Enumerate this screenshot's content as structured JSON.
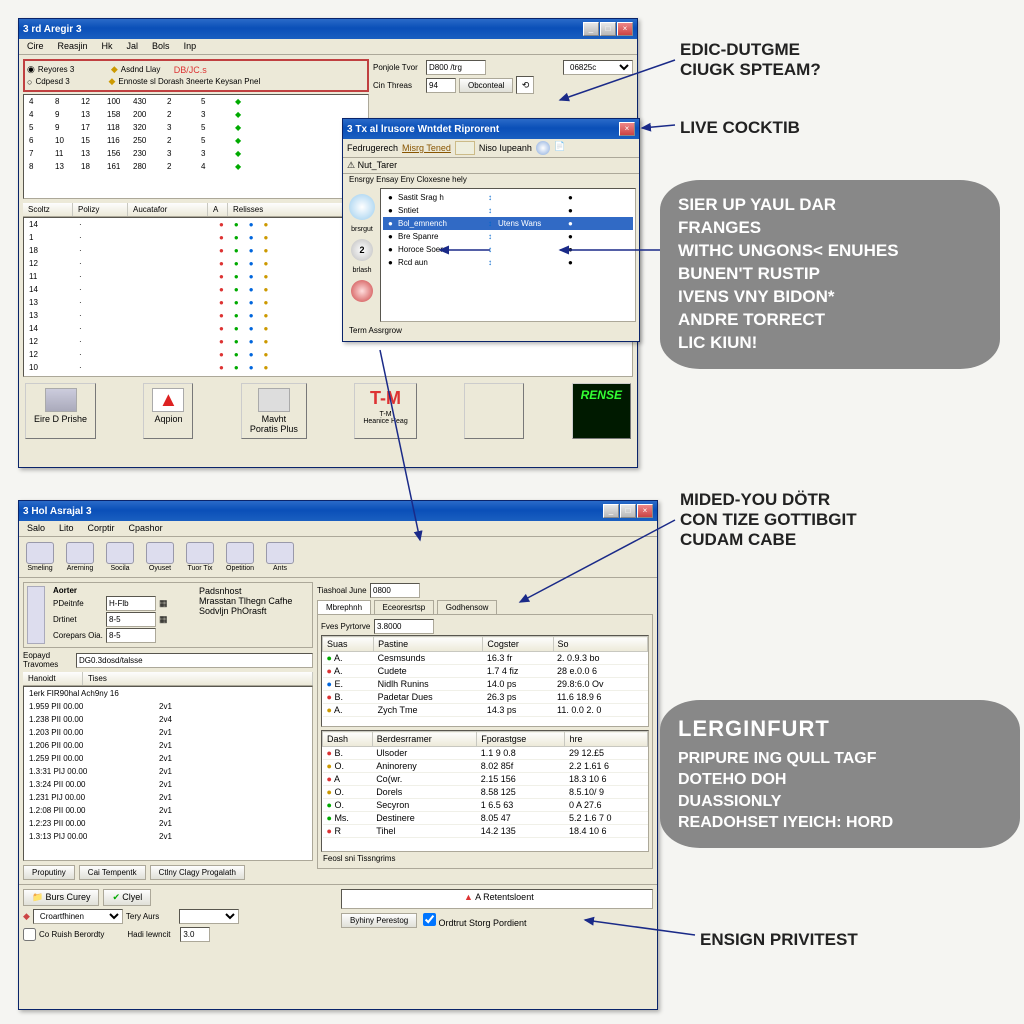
{
  "window1": {
    "title": "3 rd Aregir 3",
    "menu": [
      "Cire",
      "Reasjin",
      "Hk",
      "Jal",
      "Bols",
      "Inp"
    ],
    "check1_label": "Reyores 3",
    "check2_label": "Asdnd Llay",
    "check2_suffix": "DB/JC.s",
    "check3_label": "Cdpesd 3",
    "check4_label": "Ennoste sl Dorash 3neerte Keysan Pnel",
    "list": {
      "cols": [
        "",
        "",
        "",
        "",
        ""
      ],
      "rows": [
        [
          "4",
          "8",
          "12",
          "100",
          "430",
          "2",
          "5"
        ],
        [
          "4",
          "9",
          "13",
          "158",
          "200",
          "2",
          "3"
        ],
        [
          "5",
          "9",
          "17",
          "118",
          "320",
          "3",
          "5"
        ],
        [
          "6",
          "10",
          "15",
          "116",
          "250",
          "2",
          "5"
        ],
        [
          "7",
          "11",
          "13",
          "156",
          "230",
          "3",
          "3"
        ],
        [
          "8",
          "13",
          "18",
          "161",
          "280",
          "2",
          "4"
        ]
      ]
    },
    "toplabels": {
      "a": "Ponjole Tvor",
      "b": "Cin Threas"
    },
    "topinputs": {
      "a": "D800 /trg",
      "b": "94"
    },
    "topbtn1": "Obconteal",
    "dropdown": "06825c",
    "lower_headers": [
      "Scoltz",
      "Polizy",
      "Aucatafor",
      "A",
      "Relisses"
    ],
    "lower_rows": [
      [
        "14",
        "",
        "",
        ""
      ],
      [
        "1",
        "",
        "",
        ""
      ],
      [
        "18",
        "",
        "",
        ""
      ],
      [
        "12",
        "",
        "",
        ""
      ],
      [
        "11",
        "",
        "",
        ""
      ],
      [
        "14",
        "",
        "",
        ""
      ],
      [
        "13",
        "",
        "",
        ""
      ],
      [
        "13",
        "",
        "",
        ""
      ],
      [
        "14",
        "",
        "",
        ""
      ],
      [
        "12",
        "",
        "",
        ""
      ],
      [
        "12",
        "",
        "",
        ""
      ],
      [
        "10",
        "",
        "",
        ""
      ]
    ],
    "sponsors": [
      {
        "icon": "truck",
        "label": "Eire D Prishe"
      },
      {
        "icon": "triangle",
        "label": "Aqpion",
        "color": "#d22"
      },
      {
        "icon": "car",
        "label": "Mavht\nPoratis Plus"
      },
      {
        "icon": "tm",
        "label": "T-M\nHeanice Heag",
        "color": "#d33"
      },
      {
        "icon": "",
        "label": ""
      },
      {
        "icon": "renst",
        "label": "",
        "bg": "#003300"
      }
    ]
  },
  "popup": {
    "title": "3 Tx al lrusore Wntdet Riprorent",
    "toolbar_items": [
      "Fedrugerech",
      "Misrg Tened",
      "Niso Iupeanh"
    ],
    "subtitle": "Nut_Tarer",
    "subsubtitle": "Ensrgy Ensay Eny Cloxesne hely",
    "list_items": [
      {
        "c1": "Sastit Srag h",
        "c2": "",
        "c3": ""
      },
      {
        "c1": "Sntiet",
        "c2": "",
        "c3": ""
      },
      {
        "c1": "Bol_emnench",
        "c2": "Utens Wans",
        "c3": "",
        "sel": true
      },
      {
        "c1": "Bre Spanre",
        "c2": "",
        "c3": ""
      },
      {
        "c1": "Horoce Soers",
        "c2": "",
        "c3": ""
      },
      {
        "c1": "Rcd aun",
        "c2": "",
        "c3": ""
      }
    ],
    "footer": "Term Assrgrow"
  },
  "window2": {
    "title": "3 Hol Asrajal 3",
    "menu": [
      "Salo",
      "Lito",
      "Corptir",
      "Cpashor"
    ],
    "toolbar": [
      {
        "label": "Smeling"
      },
      {
        "label": "Arerning"
      },
      {
        "label": "Socila"
      },
      {
        "label": "Oyuset"
      },
      {
        "label": "Tuor Tix"
      },
      {
        "label": "Opetition"
      },
      {
        "label": "Ants"
      }
    ],
    "fieldlabel": "Tiashoal June",
    "fieldval": "0800",
    "tabs": [
      "Mbrephnh",
      "Eceoresrtsp",
      "Godhensow"
    ],
    "left_section": {
      "hdr": "Aorter",
      "f1": {
        "l": "PDeitnfe",
        "v": "H-Flb"
      },
      "f2": {
        "l": "Drtinet",
        "v": "8-5"
      },
      "f3": {
        "l": "Corepars Oia.",
        "v": "8-5"
      },
      "note1": "Padsnhost",
      "note2": "Mrasstan Tlhegn Cafhe",
      "note3": "Sodvljn PhOrasft",
      "orglabel": "Eopayd\nTravomes",
      "orgval": "DG0.3dosd/talsse"
    },
    "table1": {
      "header": "Fves Pyrtorve",
      "hval": "3.8000",
      "cols": [
        "Suas",
        "Pastine",
        "Cogster",
        "So"
      ],
      "rows": [
        [
          "A.",
          "Cesmsunds",
          "16.3 fr",
          "2. 0.9.3 bo"
        ],
        [
          "A.",
          "Cudete",
          "1.7 4 fiz",
          "28 e.0.0 6"
        ],
        [
          "E.",
          "Nidlh Runins",
          "14.0 ps",
          "29.8:6.0 Ov"
        ],
        [
          "B.",
          "Padetar Dues",
          "26.3 ps",
          "11.6 18.9 6"
        ],
        [
          "A.",
          "Zych Tme",
          "14.3 ps",
          "11. 0.0 2. 0"
        ]
      ]
    },
    "table2": {
      "cols": [
        "Dash",
        "Berdesrramer",
        "Fporastgse",
        "hre"
      ],
      "rows": [
        [
          "B.",
          "Ulsoder",
          "1.1 9 0.8",
          "29 12.£5"
        ],
        [
          "O.",
          "Aninoreny",
          "8.02 85f",
          "2.2 1.61 6"
        ],
        [
          "A",
          "Co(wr.",
          "2.15 156",
          "18.3 10 6"
        ],
        [
          "O.",
          "Dorels",
          "8.58 125",
          "8.5.10/ 9"
        ],
        [
          "O.",
          "Secyron",
          "1 6.5 63",
          "0 A 27.6"
        ],
        [
          "Ms.",
          "Destinere",
          "8.05 47",
          "5.2 1.6 7 0"
        ],
        [
          "R",
          "Tihel",
          "14.2 135",
          "18.4 10 6"
        ]
      ],
      "footer": "Feosl sni Tissngrims"
    },
    "log": {
      "cols": [
        "Hanoidt",
        "Tises"
      ],
      "rows": [
        [
          "1erk FIR90hal Ach9ny 16",
          ""
        ],
        [
          "1.959 PII 00.00",
          "2v1"
        ],
        [
          "1.238 PII 00.00",
          "2v4"
        ],
        [
          "1.203 PII 00.00",
          "2v1"
        ],
        [
          "1.206 PII 00.00",
          "2v1"
        ],
        [
          "1.259 PII 00.00",
          "2v1"
        ],
        [
          "1.3:31 PIJ 00.00",
          "2v1"
        ],
        [
          "1.3:24 PII 00.00",
          "2v1"
        ],
        [
          "1.231 PIJ 00.00",
          "2v1"
        ],
        [
          "1.2:08 PII 00.00",
          "2v1"
        ],
        [
          "1.2:23 PII 00.00",
          "2v1"
        ],
        [
          "1.3:13 PIJ 00.00",
          "2v1"
        ]
      ]
    },
    "bottom_btns": [
      "Proputiny",
      "Cai Tempentk",
      "Ctlny Clagy Progalath"
    ],
    "bottom_left": {
      "b1": "Burs Curey",
      "b2": "Clyel",
      "f1": "Croartfhinen",
      "f2": "Tery Aurs"
    },
    "bottom_checks": {
      "c1": "Co Ruish Berordty",
      "f": "Hadi lewncit",
      "v": "3.0"
    },
    "br1": "Byhiny Perestog",
    "br2": "Ordtrut Storg Pordient",
    "br3": "A Retentsloent"
  },
  "callouts": {
    "c1": "EDIC-DUTGME\nCIUGK SPTEAM?",
    "c2": "LIVE COCKTIB",
    "c3": "SIER UP YAUL DAR\nFRANGES\nWITHC UNGONS< ENUHES\nBUNEN'T RUSTIP\nIVENS VNY BIDON*\nANDRE TORRECT\nLIC KIUN!",
    "c4": "MIDED-YOU DÖTR\nCON TIZE GOTTIBGIT\nCUDAM CABE",
    "c5_title": "LERGINFURT",
    "c5_body": "PRIPURE ING QULL TAGF\nDOTEHO DOH\nDUASSIONLY\nREADOHSET IYEICH: HORD",
    "c6": "ENSIGN PRIVITEST"
  }
}
